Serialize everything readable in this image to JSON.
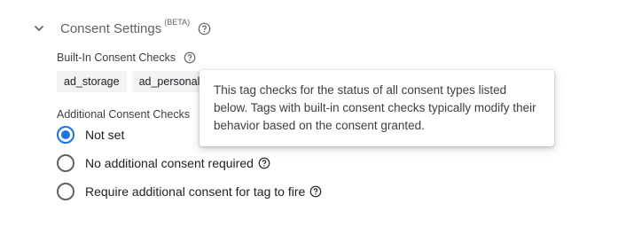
{
  "consent_settings": {
    "title": "Consent Settings",
    "badge": "(BETA)",
    "builtin": {
      "label": "Built-In Consent Checks",
      "chips": [
        "ad_storage",
        "ad_personaliz"
      ]
    },
    "additional": {
      "label": "Additional Consent Checks",
      "options": [
        {
          "label": "Not set",
          "selected": true
        },
        {
          "label": "No additional consent required",
          "selected": false
        },
        {
          "label": "Require additional consent for tag to fire",
          "selected": false
        }
      ]
    },
    "tooltip": "This tag checks for the status of all consent types listed below. Tags with built-in consent checks typically modify their behavior based on the consent granted."
  },
  "colors": {
    "accent": "#1a73e8",
    "icon": "#5f6368",
    "chip_bg": "#f1f3f4"
  }
}
